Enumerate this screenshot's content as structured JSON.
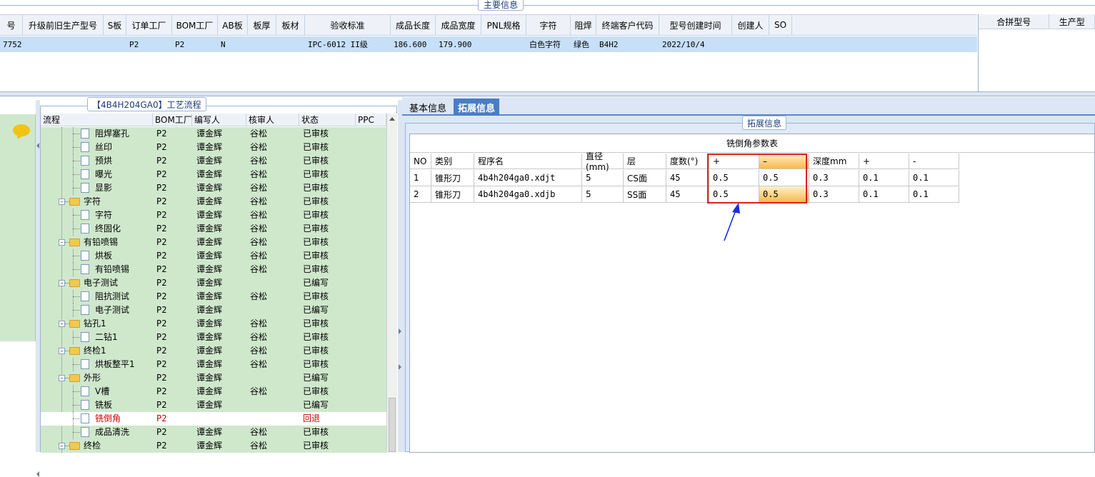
{
  "top": {
    "title": "主要信息",
    "columns": [
      "号",
      "升级前旧生产型号",
      "S板",
      "订单工厂",
      "BOM工厂",
      "AB板",
      "板厚",
      "板材",
      "验收标准",
      "成品长度",
      "成品宽度",
      "PNL规格",
      "字符",
      "阻焊",
      "终端客户代码",
      "型号创建时间",
      "创建人",
      "SO"
    ],
    "row": [
      "7752",
      "",
      "",
      "P2",
      "P2",
      "N",
      "",
      "",
      "IPC-6012 II级",
      "186.600",
      "179.900",
      "",
      "白色字符",
      "绿色",
      "B4H2",
      "2022/10/4",
      "",
      ""
    ],
    "right_columns": [
      "合拼型号",
      "生产型"
    ]
  },
  "process": {
    "title": "【4B4H204GA0】工艺流程",
    "columns": [
      "流程",
      "BOM工厂",
      "编写人",
      "核审人",
      "状态",
      "PPC"
    ],
    "rows": [
      {
        "level": 2,
        "type": "doc",
        "name": "阻焊塞孔",
        "bom": "P2",
        "writer": "谭金辉",
        "reviewer": "谷松",
        "status": "已审核"
      },
      {
        "level": 2,
        "type": "doc",
        "name": "丝印",
        "bom": "P2",
        "writer": "谭金辉",
        "reviewer": "谷松",
        "status": "已审核"
      },
      {
        "level": 2,
        "type": "doc",
        "name": "预烘",
        "bom": "P2",
        "writer": "谭金辉",
        "reviewer": "谷松",
        "status": "已审核"
      },
      {
        "level": 2,
        "type": "doc",
        "name": "曝光",
        "bom": "P2",
        "writer": "谭金辉",
        "reviewer": "谷松",
        "status": "已审核"
      },
      {
        "level": 2,
        "type": "doc",
        "name": "显影",
        "bom": "P2",
        "writer": "谭金辉",
        "reviewer": "谷松",
        "status": "已审核"
      },
      {
        "level": 1,
        "type": "folder",
        "name": "字符",
        "bom": "P2",
        "writer": "谭金辉",
        "reviewer": "谷松",
        "status": "已审核"
      },
      {
        "level": 2,
        "type": "doc",
        "name": "字符",
        "bom": "P2",
        "writer": "谭金辉",
        "reviewer": "谷松",
        "status": "已审核"
      },
      {
        "level": 2,
        "type": "doc",
        "name": "终固化",
        "bom": "P2",
        "writer": "谭金辉",
        "reviewer": "谷松",
        "status": "已审核"
      },
      {
        "level": 1,
        "type": "folder",
        "name": "有铅喷锡",
        "bom": "P2",
        "writer": "谭金辉",
        "reviewer": "谷松",
        "status": "已审核"
      },
      {
        "level": 2,
        "type": "doc",
        "name": "烘板",
        "bom": "P2",
        "writer": "谭金辉",
        "reviewer": "谷松",
        "status": "已审核"
      },
      {
        "level": 2,
        "type": "doc",
        "name": "有铅喷锡",
        "bom": "P2",
        "writer": "谭金辉",
        "reviewer": "谷松",
        "status": "已审核"
      },
      {
        "level": 1,
        "type": "folder",
        "name": "电子测试",
        "bom": "P2",
        "writer": "谭金辉",
        "reviewer": "",
        "status": "已编写"
      },
      {
        "level": 2,
        "type": "doc",
        "name": "阻抗测试",
        "bom": "P2",
        "writer": "谭金辉",
        "reviewer": "谷松",
        "status": "已审核"
      },
      {
        "level": 2,
        "type": "doc",
        "name": "电子测试",
        "bom": "P2",
        "writer": "谭金辉",
        "reviewer": "",
        "status": "已编写"
      },
      {
        "level": 1,
        "type": "folder",
        "name": "钻孔1",
        "bom": "P2",
        "writer": "谭金辉",
        "reviewer": "谷松",
        "status": "已审核"
      },
      {
        "level": 2,
        "type": "doc",
        "name": "二钻1",
        "bom": "P2",
        "writer": "谭金辉",
        "reviewer": "谷松",
        "status": "已审核"
      },
      {
        "level": 1,
        "type": "folder",
        "name": "终检1",
        "bom": "P2",
        "writer": "谭金辉",
        "reviewer": "谷松",
        "status": "已审核"
      },
      {
        "level": 2,
        "type": "doc",
        "name": "烘板整平1",
        "bom": "P2",
        "writer": "谭金辉",
        "reviewer": "谷松",
        "status": "已审核"
      },
      {
        "level": 1,
        "type": "folder",
        "name": "外形",
        "bom": "P2",
        "writer": "谭金辉",
        "reviewer": "",
        "status": "已编写"
      },
      {
        "level": 2,
        "type": "doc",
        "name": "V槽",
        "bom": "P2",
        "writer": "谭金辉",
        "reviewer": "谷松",
        "status": "已审核"
      },
      {
        "level": 2,
        "type": "doc",
        "name": "铣板",
        "bom": "P2",
        "writer": "谭金辉",
        "reviewer": "",
        "status": "已编写"
      },
      {
        "level": 2,
        "type": "doc",
        "name": "铣倒角",
        "bom": "P2",
        "writer": "",
        "reviewer": "",
        "status": "回退",
        "selected": true
      },
      {
        "level": 2,
        "type": "doc",
        "name": "成品清洗",
        "bom": "P2",
        "writer": "谭金辉",
        "reviewer": "谷松",
        "status": "已审核"
      },
      {
        "level": 1,
        "type": "folder",
        "name": "终检",
        "bom": "P2",
        "writer": "谭金辉",
        "reviewer": "谷松",
        "status": "已审核"
      }
    ]
  },
  "right": {
    "tabs": [
      "基本信息",
      "拓展信息"
    ],
    "active_tab": "拓展信息",
    "ext_title": "拓展信息",
    "table_title": "铣倒角参数表",
    "columns": [
      "NO",
      "类别",
      "程序名",
      "直径(mm)",
      "层",
      "度数(°)",
      "+",
      "–",
      "深度mm",
      "+",
      "-"
    ],
    "rows": [
      [
        "1",
        "锥形刀",
        "4b4h204ga0.xdjt",
        "5",
        "CS面",
        "45",
        "0.5",
        "0.5",
        "0.3",
        "0.1",
        "0.1"
      ],
      [
        "2",
        "锥形刀",
        "4b4h204ga0.xdjb",
        "5",
        "SS面",
        "45",
        "0.5",
        "0.5",
        "0.3",
        "0.1",
        "0.1"
      ]
    ]
  },
  "colors": {
    "accent": "#4b7dc4",
    "tree_bg": "#cfe8cc",
    "selected_text": "#d00000",
    "highlight": "#f7b94d",
    "annotation": "#e02020",
    "arrow": "#1a2ee0"
  }
}
